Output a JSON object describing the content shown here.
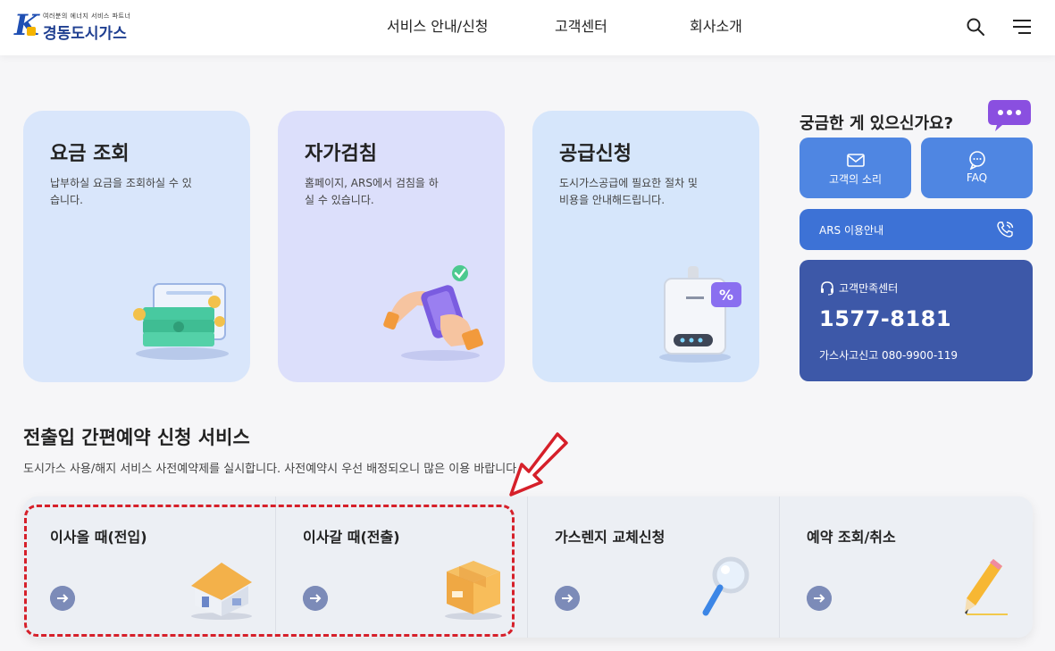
{
  "brand": {
    "tagline": "여러분의 에너지 서비스 파트너",
    "name": "경동도시가스",
    "colors": {
      "primary": "#1f3f91",
      "accent": "#f5b400"
    }
  },
  "nav": {
    "items": [
      "서비스 안내/신청",
      "고객센터",
      "회사소개"
    ]
  },
  "header_icons": {
    "search": "search-icon",
    "menu": "menu-icon"
  },
  "cards": [
    {
      "title": "요금 조회",
      "desc": "납부하실 요금을 조회하실 수 있습니다.",
      "icon": "money-icon"
    },
    {
      "title": "자가검침",
      "desc": "홈페이지, ARS에서 검침을 하실 수 있습니다.",
      "icon": "phone-hand-icon"
    },
    {
      "title": "공급신청",
      "desc": "도시가스공급에 필요한 절차 및 비용을 안내해드립니다.",
      "icon": "boiler-icon"
    }
  ],
  "side": {
    "title": "궁금한 게 있으신가요?",
    "voice_label": "고객의 소리",
    "faq_label": "FAQ",
    "ars_label": "ARS 이용안내",
    "center": {
      "head": "고객만족센터",
      "phone": "1577-8181",
      "accident": "가스사고신고 080-9900-119"
    }
  },
  "service": {
    "title": "전출입 간편예약 신청 서비스",
    "desc": "도시가스 사용/해지 서비스 사전예약제를 실시합니다. 사전예약시 우선 배정되오니 많은 이용 바랍니다.",
    "items": [
      {
        "label": "이사올 때(전입)",
        "icon": "house-icon"
      },
      {
        "label": "이사갈 때(전출)",
        "icon": "box-icon"
      },
      {
        "label": "가스렌지 교체신청",
        "icon": "magnifier-icon"
      },
      {
        "label": "예약 조회/취소",
        "icon": "pencil-icon"
      }
    ]
  }
}
